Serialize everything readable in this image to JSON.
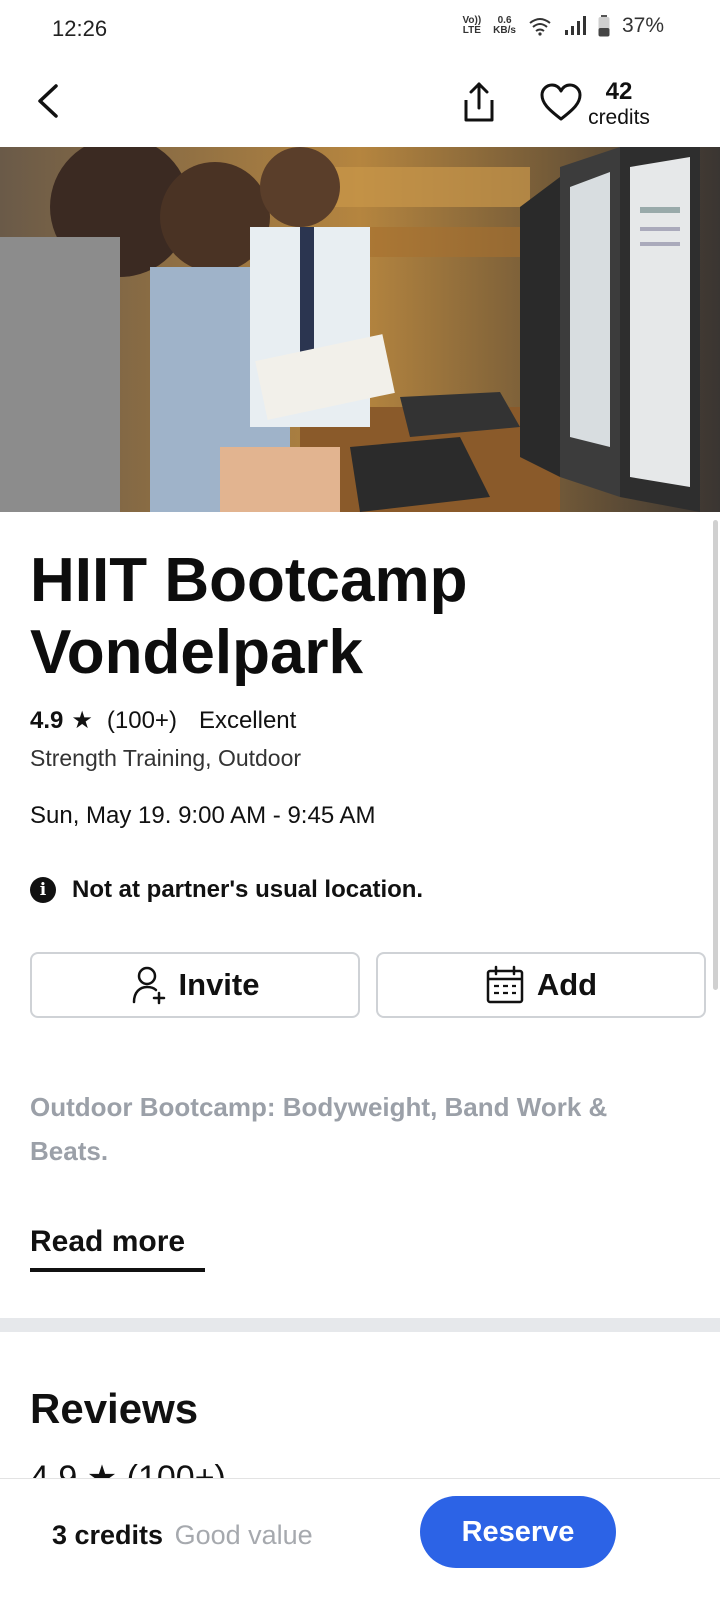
{
  "status_bar": {
    "time": "12:26",
    "volte_top": "Vo))",
    "volte_bottom": "LTE",
    "speed_top": "0.6",
    "speed_bottom": "KB/s",
    "battery": "37%"
  },
  "header": {
    "credits_number": "42",
    "credits_label": "credits",
    "icons": [
      "chevron-left-icon",
      "share-icon",
      "heart-icon"
    ]
  },
  "event": {
    "title_line1": "HIIT Bootcamp",
    "title_line2": "Vondelpark",
    "rating": "4.9",
    "rating_count": "(100+)",
    "rating_label": "Excellent",
    "categories": "Strength Training, Outdoor",
    "datetime": "Sun, May 19.  9:00 AM - 9:45 AM",
    "notice": "Not at partner's usual location."
  },
  "actions": {
    "invite_label": "Invite",
    "add_label": "Add"
  },
  "description": {
    "text": "Outdoor Bootcamp: Bodyweight, Band Work & Beats.",
    "read_more": "Read more"
  },
  "reviews": {
    "title": "Reviews",
    "peek": "4.9 ★ (100+)"
  },
  "footer": {
    "credits": "3 credits",
    "value_label": "Good value",
    "reserve_label": "Reserve"
  },
  "colors": {
    "accent": "#2c63e6",
    "muted_text": "#9ba0a8",
    "divider": "#e6e8eb"
  }
}
